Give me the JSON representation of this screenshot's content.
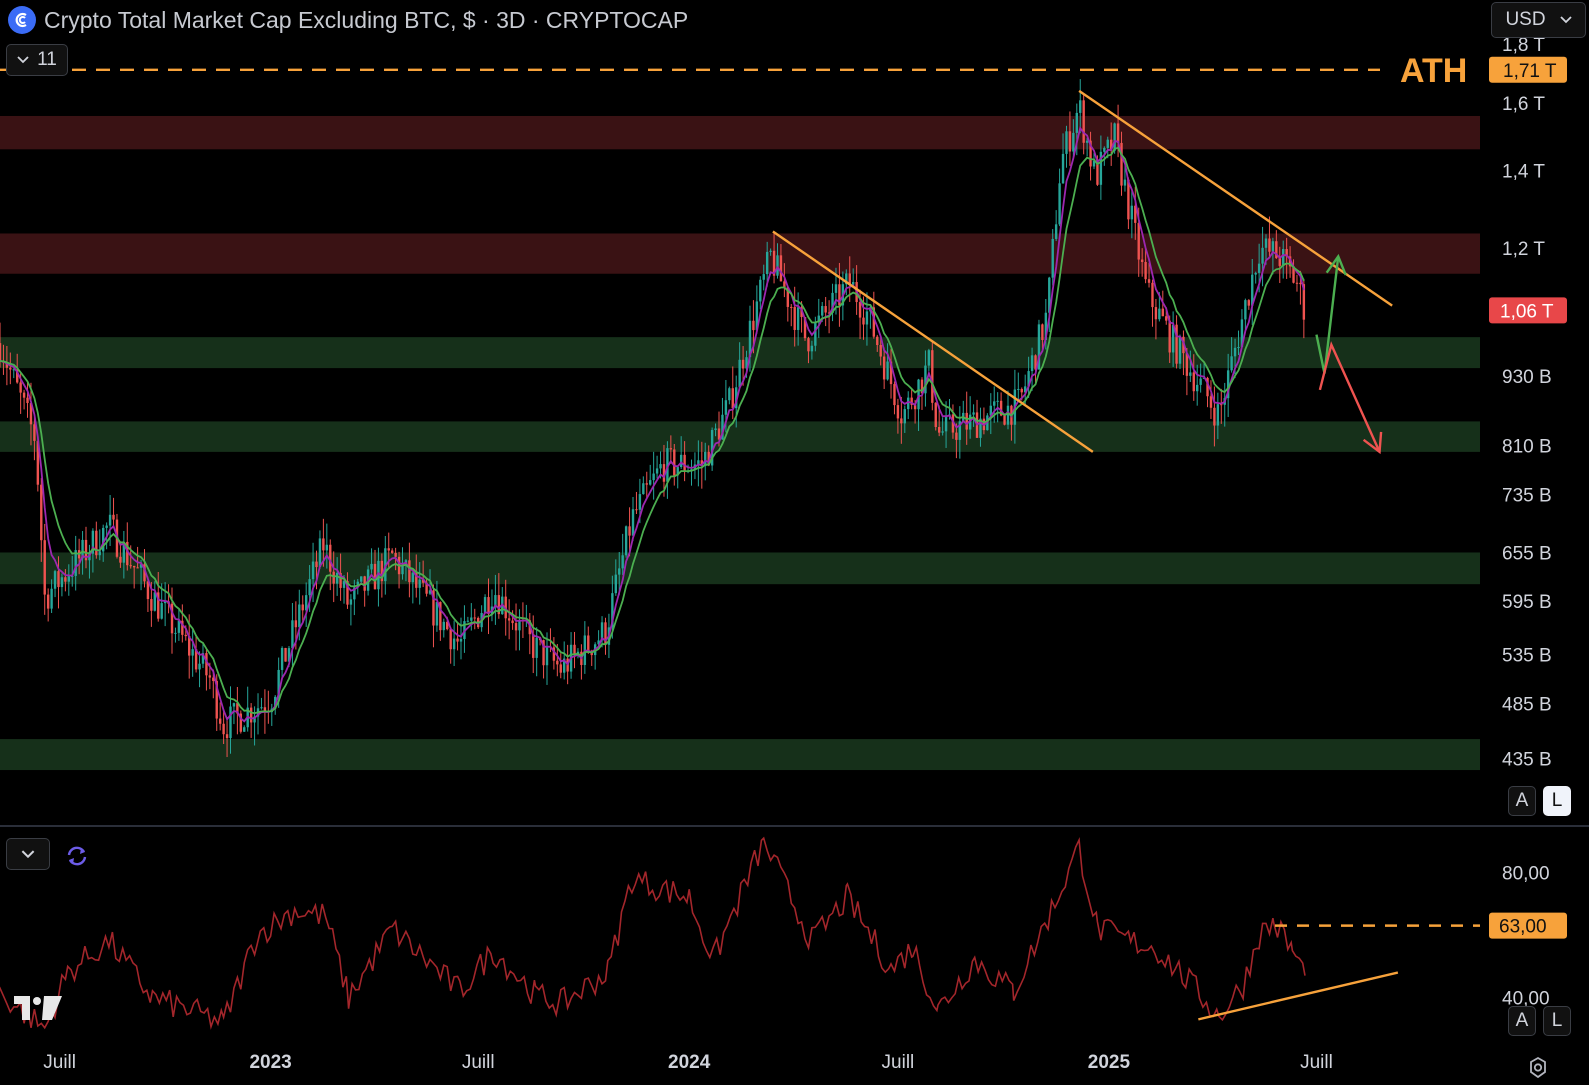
{
  "header": {
    "title": "Crypto Total Market Cap Excluding BTC, $ · 3D · CRYPTOCAP",
    "currency": "USD",
    "indicator_count": "11",
    "scale_auto": "A",
    "scale_log": "L",
    "logo_icon": "cryptocap-logo-icon",
    "tradingview_logo": "tradingview-logo-icon"
  },
  "colors": {
    "background": "#000000",
    "candle_up": "#26a69a",
    "candle_down": "#ef5350",
    "trendline": "#f7a23b",
    "resistance_zone": "#3a1214",
    "support_zone": "#16301a",
    "ema_fast": "#9c27b0",
    "ema_slow": "#4caf50",
    "rsi_line": "#a3262b",
    "up_arrow": "#4caf50",
    "down_arrow": "#ef5350",
    "price_label": "#e84749"
  },
  "chart_data": [
    {
      "type": "candlestick",
      "title": "Crypto Total Market Cap Excluding BTC, $ · 3D · CRYPTOCAP",
      "scale": "log",
      "x_labels": [
        "Juill",
        "2023",
        "Juill",
        "2024",
        "Juill",
        "2025",
        "Juill"
      ],
      "y_tick_labels": [
        "1,8 T",
        "1,6 T",
        "1,4 T",
        "1,2 T",
        "930 B",
        "810 B",
        "735 B",
        "655 B",
        "595 B",
        "535 B",
        "485 B",
        "435 B"
      ],
      "y_ticks_values_b": [
        1800,
        1600,
        1400,
        1200,
        930,
        810,
        735,
        655,
        595,
        535,
        485,
        435
      ],
      "ylim_b": [
        420,
        1800
      ],
      "price_anchors": {
        "dates": [
          "2022-05-01",
          "2022-06-10",
          "2022-06-18",
          "2022-08-13",
          "2022-09-20",
          "2022-11-09",
          "2022-11-21",
          "2023-01-01",
          "2023-02-16",
          "2023-03-10",
          "2023-04-17",
          "2023-06-15",
          "2023-07-14",
          "2023-08-17",
          "2023-09-11",
          "2023-10-20",
          "2023-11-12",
          "2023-12-09",
          "2024-01-12",
          "2024-02-05",
          "2024-03-12",
          "2024-04-12",
          "2024-05-20",
          "2024-06-05",
          "2024-07-05",
          "2024-07-28",
          "2024-08-05",
          "2024-09-06",
          "2024-10-15",
          "2024-11-08",
          "2024-11-20",
          "2024-12-06",
          "2024-12-20",
          "2025-01-06",
          "2025-02-03",
          "2025-02-25",
          "2025-04-07",
          "2025-04-23",
          "2025-05-12",
          "2025-05-30",
          "2025-06-14",
          "2025-06-21"
        ],
        "close_b": [
          1050,
          820,
          600,
          690,
          600,
          510,
          465,
          490,
          665,
          590,
          650,
          545,
          610,
          545,
          520,
          560,
          700,
          780,
          780,
          880,
          1180,
          1000,
          1120,
          1050,
          860,
          950,
          830,
          850,
          880,
          1050,
          1420,
          1590,
          1380,
          1490,
          1100,
          1000,
          860,
          1000,
          1200,
          1180,
          1120,
          1060
        ]
      },
      "reference_lines": [
        {
          "label": "ATH",
          "value_label": "1,71 T",
          "value_b": 1710,
          "style": "dashed"
        }
      ],
      "current_price_label": "1,06 T",
      "current_price_b": 1060,
      "zones": [
        {
          "type": "resistance",
          "range_b": [
            1460,
            1560
          ]
        },
        {
          "type": "resistance",
          "range_b": [
            1140,
            1235
          ]
        },
        {
          "type": "support",
          "range_b": [
            945,
            1005
          ]
        },
        {
          "type": "support",
          "range_b": [
            800,
            850
          ]
        },
        {
          "type": "support",
          "range_b": [
            615,
            655
          ]
        },
        {
          "type": "support",
          "range_b": [
            425,
            452
          ]
        }
      ],
      "trendlines": [
        {
          "from": {
            "date": "2024-03-14",
            "value_b": 1240
          },
          "to": {
            "date": "2024-12-18",
            "value_b": 800
          }
        },
        {
          "from": {
            "date": "2024-12-06",
            "value_b": 1640
          },
          "to": {
            "date": "2025-09-05",
            "value_b": 1070
          }
        }
      ],
      "scenario_arrows": [
        {
          "direction": "up",
          "path": [
            {
              "date": "2025-07-01",
              "value_b": 1010
            },
            {
              "date": "2025-07-08",
              "value_b": 935
            },
            {
              "date": "2025-07-20",
              "value_b": 1180
            }
          ]
        },
        {
          "direction": "down",
          "path": [
            {
              "date": "2025-07-04",
              "value_b": 905
            },
            {
              "date": "2025-07-14",
              "value_b": 990
            },
            {
              "date": "2025-08-25",
              "value_b": 800
            }
          ]
        }
      ],
      "legend": "none",
      "grid": false
    },
    {
      "type": "line",
      "indicator": "RSI",
      "y_tick_labels": [
        "80,00",
        "40,00"
      ],
      "y_ticks": [
        80,
        40
      ],
      "ylim": [
        28,
        92
      ],
      "level_label": "63,00",
      "level_value": 63,
      "series": [
        {
          "x": [
            "2022-05-01",
            "2022-06-18",
            "2022-07-08",
            "2022-08-13",
            "2022-09-20",
            "2022-11-21",
            "2022-12-20",
            "2023-01-22",
            "2023-02-18",
            "2023-03-10",
            "2023-04-17",
            "2023-06-15",
            "2023-07-14",
            "2023-08-20",
            "2023-09-11",
            "2023-10-22",
            "2023-11-12",
            "2024-01-01",
            "2024-01-22",
            "2024-03-06",
            "2024-04-17",
            "2024-05-18",
            "2024-06-25",
            "2024-07-14",
            "2024-08-05",
            "2024-09-06",
            "2024-10-10",
            "2024-11-12",
            "2024-12-06",
            "2024-12-22",
            "2025-01-20",
            "2025-02-10",
            "2025-03-12",
            "2025-04-07",
            "2025-04-28",
            "2025-05-12",
            "2025-05-25",
            "2025-06-10",
            "2025-06-21"
          ],
          "y": [
            44,
            30,
            48,
            58,
            40,
            32,
            60,
            68,
            66,
            40,
            62,
            42,
            55,
            41,
            38,
            48,
            78,
            72,
            52,
            90,
            58,
            72,
            49,
            56,
            36,
            52,
            42,
            68,
            88,
            62,
            58,
            56,
            45,
            34,
            44,
            60,
            64,
            55,
            47
          ]
        }
      ],
      "trendline": {
        "from": {
          "date": "2025-03-20",
          "value": 33
        },
        "to": {
          "date": "2025-09-10",
          "value": 48
        }
      }
    }
  ]
}
